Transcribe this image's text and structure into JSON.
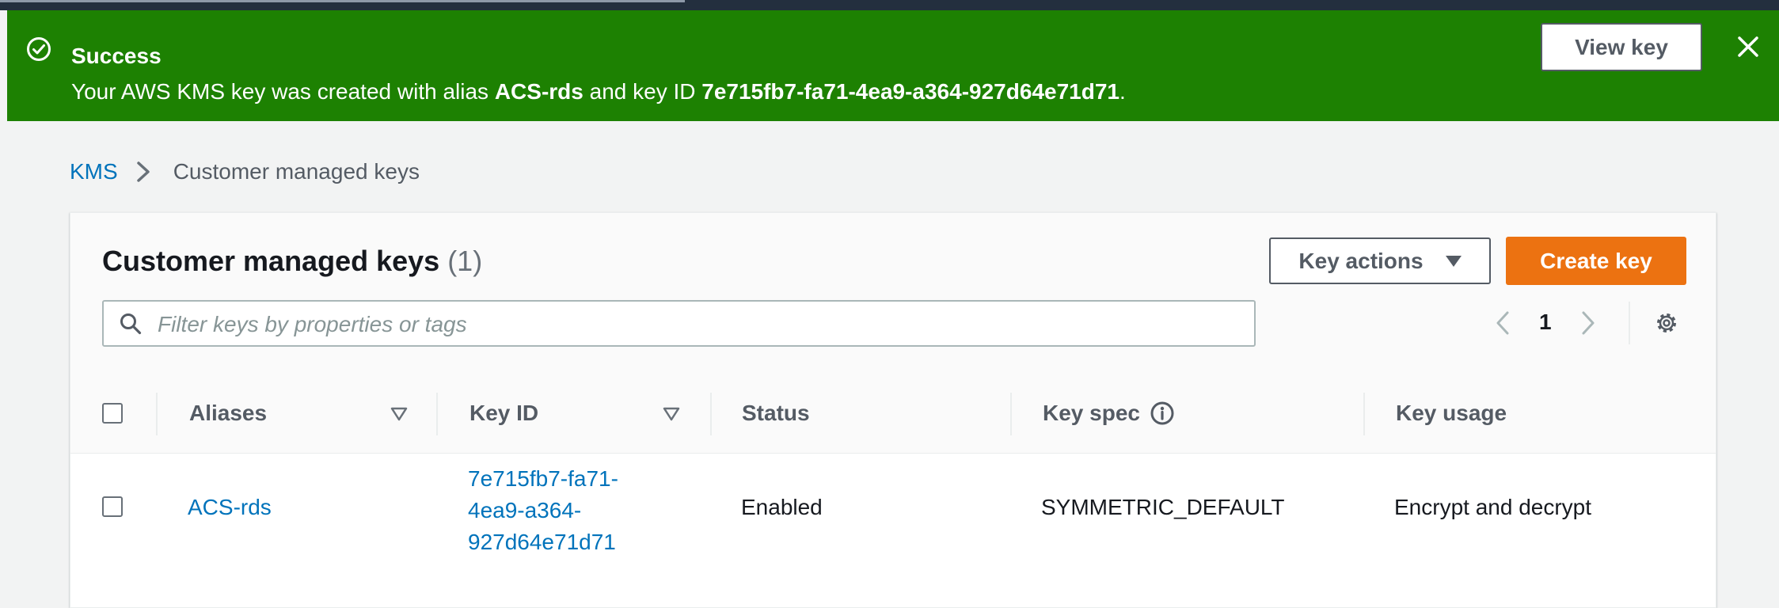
{
  "flash": {
    "title": "Success",
    "message_prefix": "Your AWS KMS key was created with alias ",
    "alias": "ACS-rds",
    "message_mid": " and key ID ",
    "key_id": "7e715fb7-fa71-4ea9-a364-927d64e71d71",
    "message_suffix": ".",
    "view_key_label": "View key",
    "color": "#1d8102"
  },
  "breadcrumb": {
    "root": "KMS",
    "current": "Customer managed keys"
  },
  "table_panel": {
    "title": "Customer managed keys",
    "count": "(1)",
    "key_actions_label": "Key actions",
    "create_key_label": "Create key",
    "filter_placeholder": "Filter keys by properties or tags",
    "page_number": "1",
    "columns": [
      "Aliases",
      "Key ID",
      "Status",
      "Key spec",
      "Key usage"
    ],
    "rows": [
      {
        "alias": "ACS-rds",
        "key_id_lines": [
          "7e715fb7-fa71-",
          "4ea9-a364-",
          "927d64e71d71"
        ],
        "status": "Enabled",
        "key_spec": "SYMMETRIC_DEFAULT",
        "key_usage": "Encrypt and decrypt"
      }
    ]
  },
  "colors": {
    "primary_button": "#ec7211",
    "link": "#0073bb",
    "top_nav": "#232f3e"
  },
  "icons": [
    "success-check-icon",
    "close-icon",
    "chevron-right-icon",
    "search-icon",
    "caret-down-icon",
    "chevron-left-icon",
    "settings-gear-icon",
    "sort-down-icon",
    "info-icon"
  ]
}
